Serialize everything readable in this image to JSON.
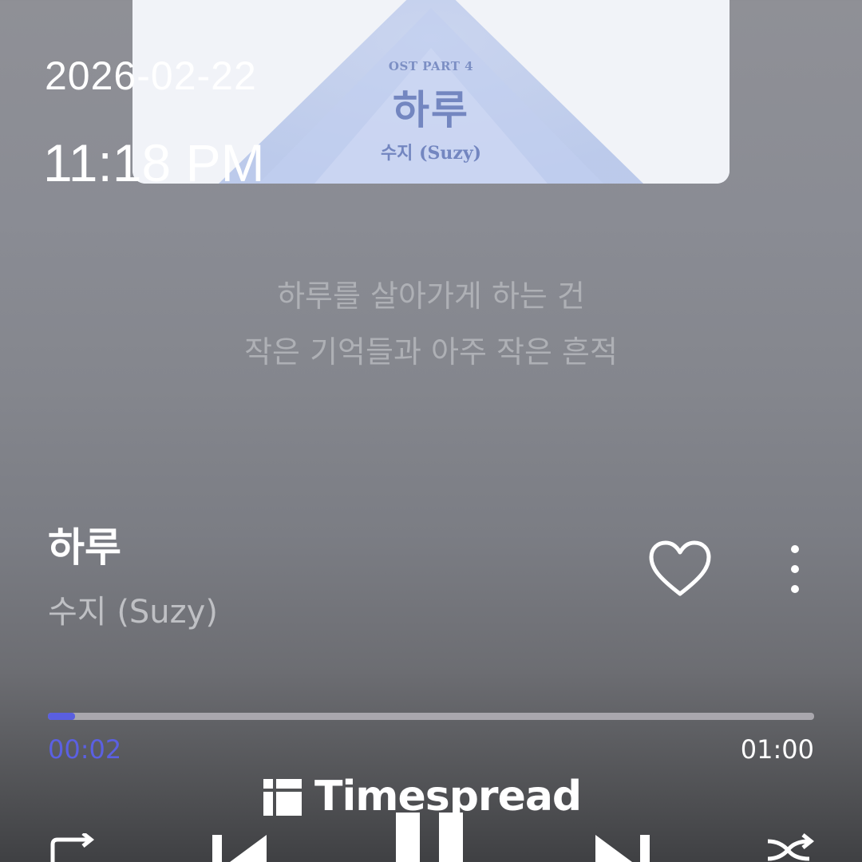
{
  "album_art": {
    "subtitle": "OST PART 4",
    "title": "하루",
    "artist": "수지 (Suzy)"
  },
  "status": {
    "date": "2026-02-22",
    "time": "11:18 PM"
  },
  "lyrics": {
    "lines": [
      "하루를 살아가게 하는 건",
      "작은 기억들과 아주 작은 흔적"
    ]
  },
  "track": {
    "title": "하루",
    "artist": "수지 (Suzy)",
    "liked": false
  },
  "player": {
    "current_time": "00:02",
    "total_time": "01:00",
    "progress_fraction": 0.035,
    "accent_color": "#5b60e2",
    "state": "playing"
  },
  "watermark": {
    "text": "Timespread"
  },
  "controls": {
    "icons": [
      "repeat-icon",
      "previous-icon",
      "pause-icon",
      "next-icon",
      "shuffle-icon"
    ]
  }
}
